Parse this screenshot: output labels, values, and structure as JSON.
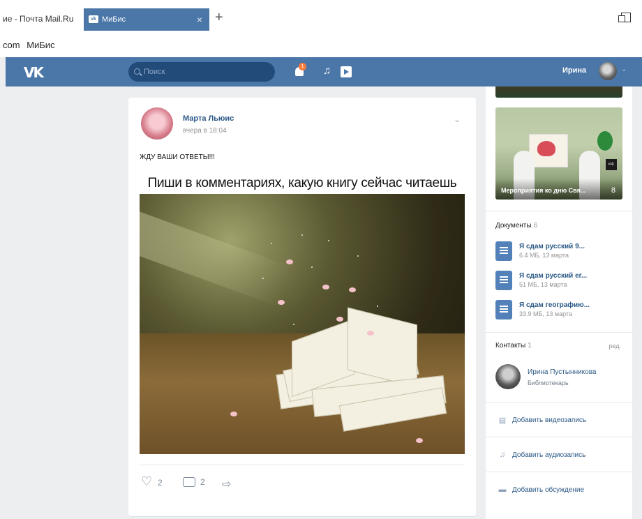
{
  "browser": {
    "prev_tab": "ие - Почта Mail.Ru",
    "active_tab": "МиБис",
    "active_tab_icon": "vk-icon",
    "close_glyph": "×",
    "new_tab_glyph": "+",
    "bookmarks": [
      "com",
      "МиБис"
    ]
  },
  "header": {
    "logo": "VK",
    "search_placeholder": "Поиск",
    "notification_count": "1",
    "music_glyph": "♫",
    "user_name": "Ирина",
    "chevron": "⌄",
    "accent": "#4a76a8"
  },
  "post": {
    "author": "Марта Льюис",
    "time": "вчера в 18:04",
    "text": "ЖДУ ВАШИ ОТВЕТЫ!!!",
    "caption": "Пиши в комментариях, какую книгу сейчас читаешь",
    "likes": "2",
    "comments": "2",
    "share_glyph": "⇨",
    "menu_glyph": "⌄"
  },
  "sidebar": {
    "photo_caption": "Мероприятия ко дню Свя...",
    "photo_count": "8",
    "photo_arrow": "⇨",
    "documents": {
      "title": "Документы",
      "count": "6",
      "items": [
        {
          "name": "Я сдам русский 9...",
          "meta": "6.4 МБ, 13 марта"
        },
        {
          "name": "Я сдам русский ег...",
          "meta": "51 МБ, 13 марта"
        },
        {
          "name": "Я сдам географию...",
          "meta": "33.9 МБ, 13 марта"
        }
      ]
    },
    "contacts": {
      "title": "Контакты",
      "count": "1",
      "edit": "ред.",
      "name": "Ирина Пустынникова",
      "role": "Библиотекарь"
    },
    "links": [
      {
        "label": "Добавить видеозапись",
        "icon": "video-icon",
        "glyph": "▤"
      },
      {
        "label": "Добавить аудиозапись",
        "icon": "music-icon",
        "glyph": "♫"
      },
      {
        "label": "Добавить обсуждение",
        "icon": "discussion-icon",
        "glyph": "▬"
      }
    ]
  }
}
